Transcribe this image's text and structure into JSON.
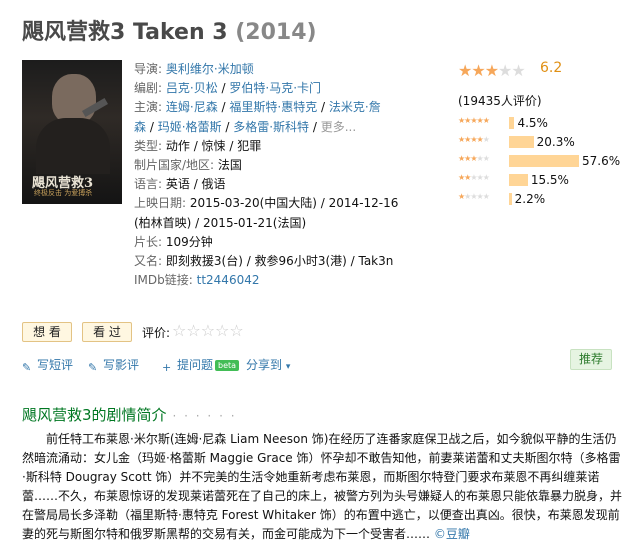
{
  "title": {
    "main": "飓风营救3 Taken 3",
    "year": "(2014)"
  },
  "poster": {
    "title": "飓风营救3",
    "subtitle": "终极反击 为爱搏杀"
  },
  "info": {
    "director_label": "导演:",
    "director": "奥利维尔·米加顿",
    "writer_label": "编剧:",
    "writers": [
      "吕克·贝松",
      "罗伯特·马克·卡门"
    ],
    "cast_label": "主演:",
    "cast_line1": [
      "连姆·尼森",
      "福里斯特·惠特克",
      "法米克·詹"
    ],
    "cast_line2": [
      "森",
      "玛姬·格蕾斯",
      "多格雷·斯科特",
      "更多..."
    ],
    "genre_label": "类型:",
    "genre": "动作 / 惊悚 / 犯罪",
    "country_label": "制片国家/地区:",
    "country": "法国",
    "language_label": "语言:",
    "language": "英语 / 俄语",
    "release_label": "上映日期:",
    "release_line1": "2015-03-20(中国大陆) / 2014-12-16",
    "release_line2": "(柏林首映) / 2015-01-21(法国)",
    "runtime_label": "片长:",
    "runtime": "109分钟",
    "aka_label": "又名:",
    "aka": "即刻救援3(台) / 救参96小时3(港) / Tak3n",
    "imdb_label": "IMDb链接:",
    "imdb": "tt2446042"
  },
  "rating": {
    "score": "6.2",
    "stars_filled": 3,
    "votes": "(19435人评价)",
    "distribution": [
      {
        "stars": 5,
        "pct": "4.5%",
        "value": 4.5
      },
      {
        "stars": 4,
        "pct": "20.3%",
        "value": 20.3
      },
      {
        "stars": 3,
        "pct": "57.6%",
        "value": 57.6
      },
      {
        "stars": 2,
        "pct": "15.5%",
        "value": 15.5
      },
      {
        "stars": 1,
        "pct": "2.2%",
        "value": 2.2
      }
    ]
  },
  "actions": {
    "want": "想 看",
    "seen": "看 过",
    "rate_label": "评价:",
    "rate_stars": "☆☆☆☆☆"
  },
  "tools": {
    "short_review": "写短评",
    "review": "写影评",
    "ask": "提问题",
    "beta": "beta",
    "share": "分享到",
    "recommend": "推荐"
  },
  "synopsis": {
    "heading": "飓风营救3的剧情简介",
    "dots": "· · · · · ·",
    "text": "前任特工布莱恩·米尔斯(连姆·尼森 Liam Neeson 饰)在经历了连番家庭保卫战之后，如今貌似平静的生活仍然暗流涌动：女儿金（玛姬·格蕾斯 Maggie Grace 饰）怀孕却不敢告知他，前妻莱诺蕾和丈夫斯图尔特（多格雷·斯科特 Dougray Scott 饰）并不完美的生活令她重新考虑布莱恩，而斯图尔特登门要求布莱恩不再纠缠莱诺蕾……不久，布莱恩惊讶的发现莱诺蕾死在了自己的床上，被警方列为头号嫌疑人的布莱恩只能依靠暴力脱身，并在警局局长多泽勒（福里斯特·惠特克 Forest Whitaker 饰）的布置中逃亡，以便查出真凶。很快，布莱恩发现前妻的死与斯图尔特和俄罗斯黑帮的交易有关，而金可能成为下一个受害者……",
    "source": "©豆瓣"
  },
  "colors": {
    "accent_link": "#3377aa",
    "synopsis_heading": "#007722",
    "rating_bar": "#ffd596",
    "score": "#e09015"
  }
}
